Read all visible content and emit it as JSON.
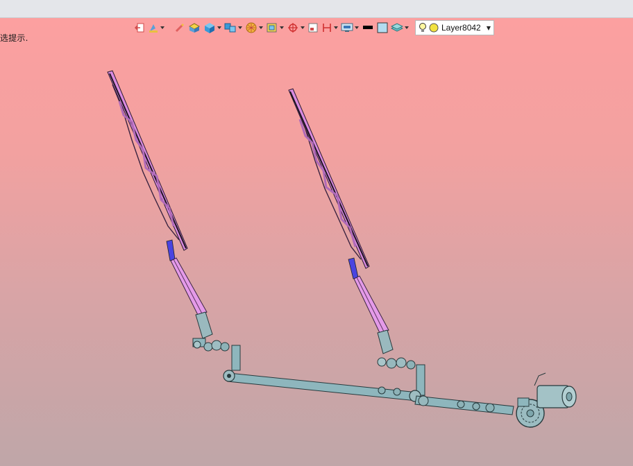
{
  "hint_text": "选提示.",
  "toolbar": {
    "items": [
      {
        "icon": "exit-arrow-icon",
        "dropdown": false
      },
      {
        "icon": "style-paint-icon",
        "dropdown": true
      },
      {
        "icon": "pick-pen-icon",
        "dropdown": false
      },
      {
        "icon": "solid-shaded-icon",
        "dropdown": false
      },
      {
        "icon": "view-cube-icon",
        "dropdown": true
      },
      {
        "icon": "multi-view-icon",
        "dropdown": true
      },
      {
        "icon": "render-sphere-icon",
        "dropdown": true
      },
      {
        "icon": "fit-all-icon",
        "dropdown": true
      },
      {
        "icon": "snap-target-icon",
        "dropdown": true
      },
      {
        "icon": "zoom-window-icon",
        "dropdown": false
      },
      {
        "icon": "section-view-icon",
        "dropdown": true
      },
      {
        "icon": "display-monitor-icon",
        "dropdown": true
      },
      {
        "icon": "line-color-icon",
        "dropdown": false
      },
      {
        "icon": "fill-color-icon",
        "dropdown": false
      },
      {
        "icon": "layer-stack-icon",
        "dropdown": true
      }
    ]
  },
  "layer": {
    "name": "Layer8042",
    "icons": [
      "lightbulb-icon",
      "layer-color-circle-icon"
    ]
  },
  "colors": {
    "background_top": "#fca0a0",
    "background_bottom": "#bfa6a8",
    "wiper_blade": "#e08ae6",
    "wiper_blade_dark": "#3a2340",
    "linkage": "#8eb6bd",
    "linkage_edge": "#26393c",
    "blue_connector": "#4a44e0"
  }
}
